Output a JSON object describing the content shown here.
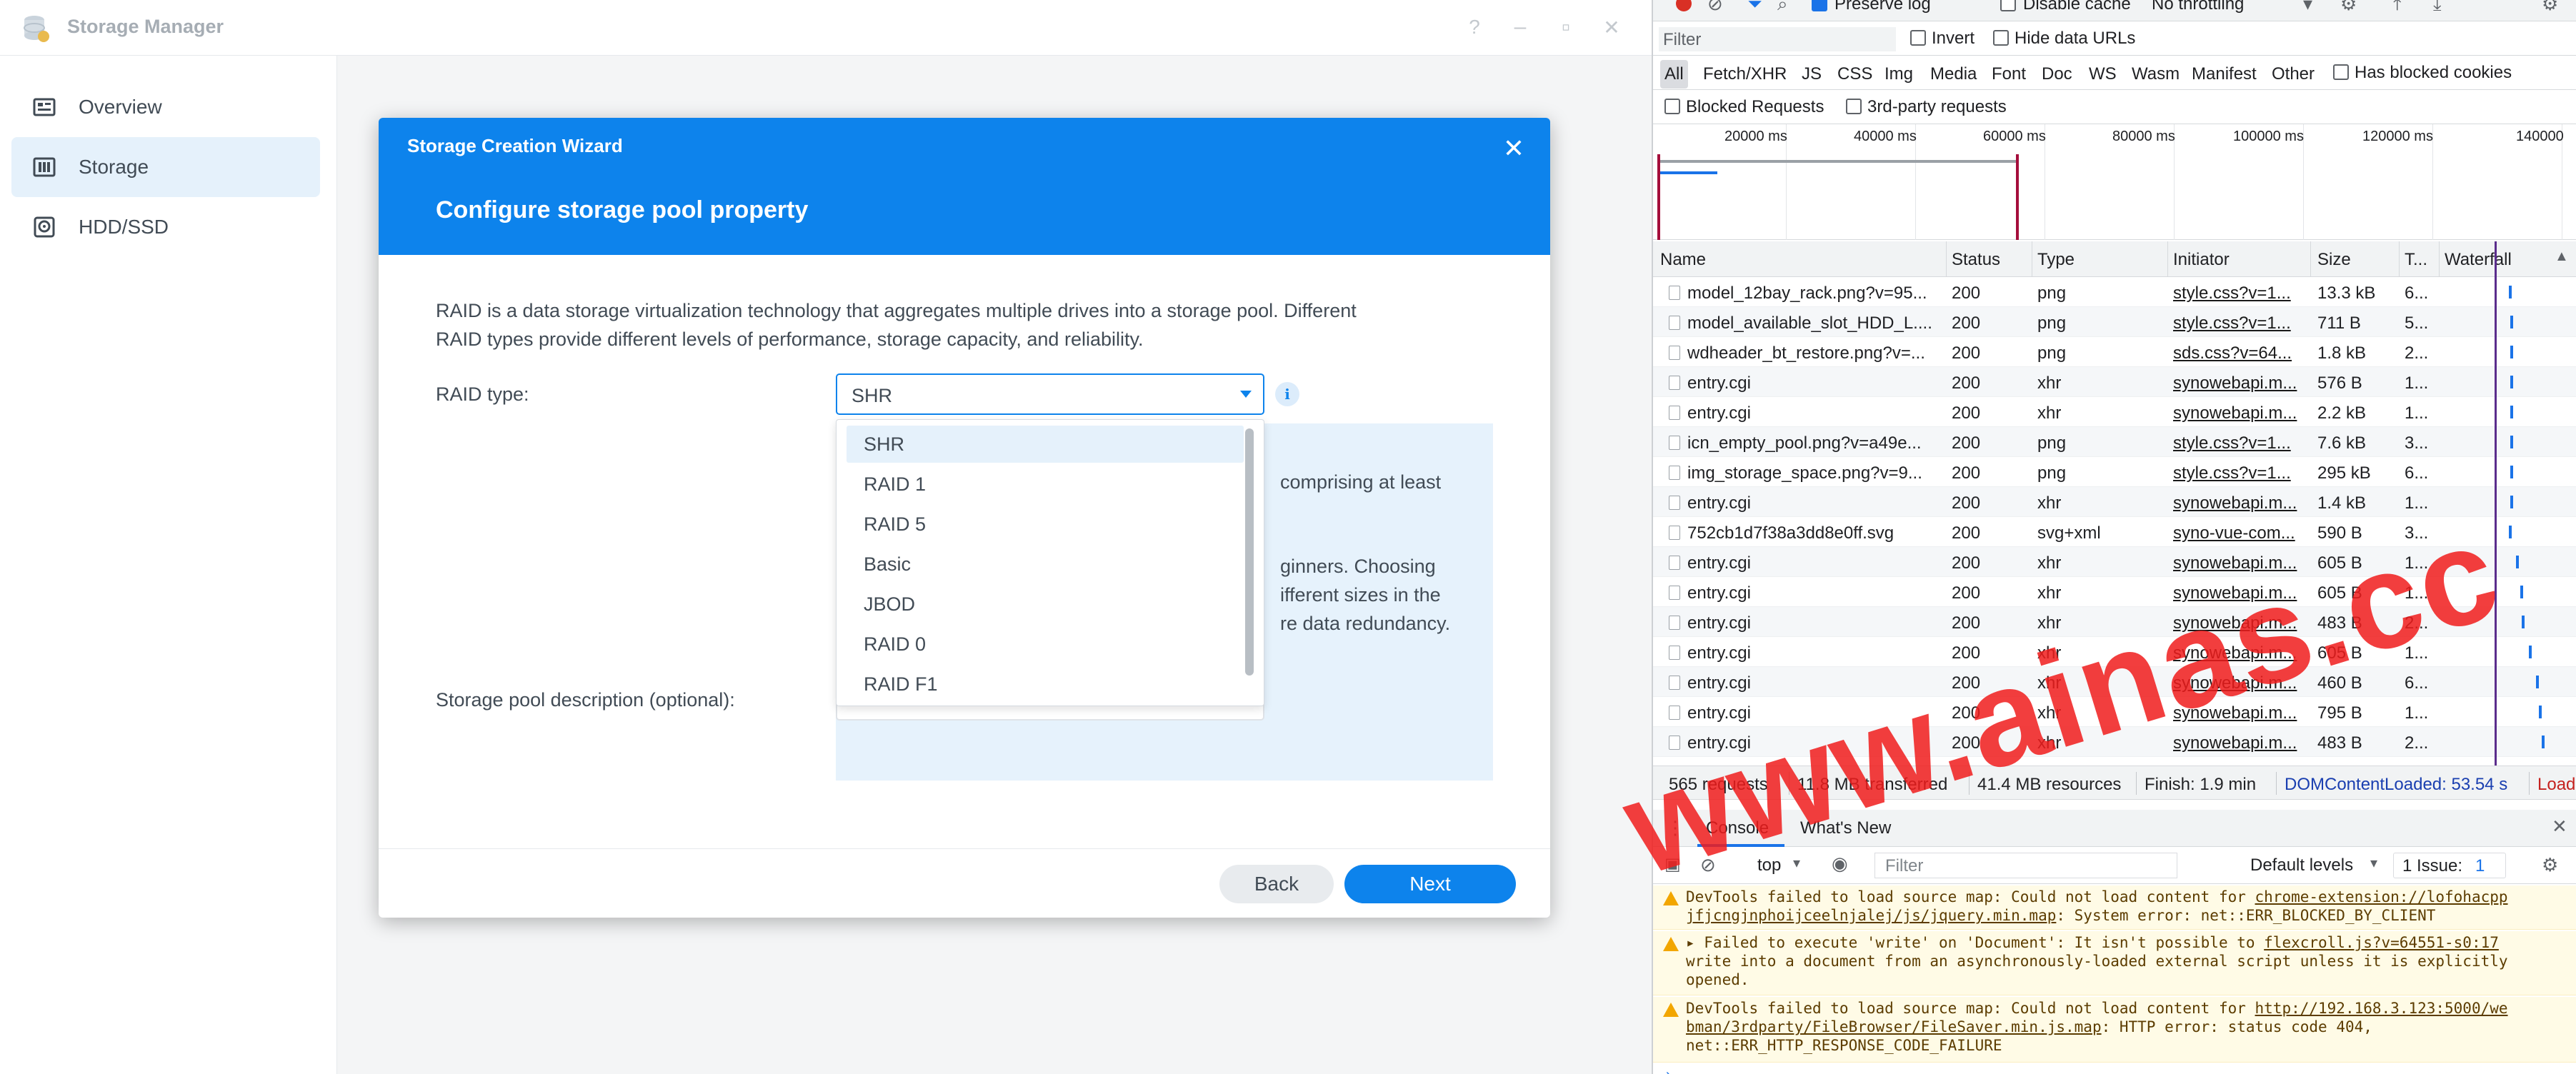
{
  "app": {
    "title": "Storage Manager",
    "window_buttons": [
      "?",
      "–",
      "▫",
      "✕"
    ]
  },
  "sidebar": {
    "items": [
      {
        "label": "Overview",
        "icon": "overview-icon",
        "active": false
      },
      {
        "label": "Storage",
        "icon": "storage-icon",
        "active": true
      },
      {
        "label": "HDD/SSD",
        "icon": "hdd-icon",
        "active": false
      }
    ]
  },
  "wizard": {
    "app_title": "Storage Creation Wizard",
    "close_glyph": "✕",
    "title": "Configure storage pool property",
    "description_line1": "RAID is a data storage virtualization technology that aggregates multiple drives into a storage pool. Different",
    "description_line2": "RAID types provide different levels of performance, storage capacity, and reliability.",
    "raid_label": "RAID type:",
    "raid_value": "SHR",
    "info_glyph": "i",
    "info_fragments": [
      "comprising at least",
      "ginners. Choosing",
      "ifferent sizes in the",
      "re data redundancy."
    ],
    "raid_options": [
      "SHR",
      "RAID 1",
      "RAID 5",
      "Basic",
      "JBOD",
      "RAID 0",
      "RAID F1"
    ],
    "desc_label": "Storage pool description (optional):",
    "back_label": "Back",
    "next_label": "Next"
  },
  "devtools": {
    "top_row": {
      "preserve_log": "Preserve log",
      "disable_cache": "Disable cache",
      "throttling": "No throttling"
    },
    "filter": {
      "placeholder": "Filter",
      "invert": "Invert",
      "hide_data_urls": "Hide data URLs"
    },
    "type_filters": [
      "All",
      "Fetch/XHR",
      "JS",
      "CSS",
      "Img",
      "Media",
      "Font",
      "Doc",
      "WS",
      "Wasm",
      "Manifest",
      "Other"
    ],
    "has_blocked_cookies": "Has blocked cookies",
    "blocked_requests": "Blocked Requests",
    "third_party": "3rd-party requests",
    "timeline_labels": [
      "20000 ms",
      "40000 ms",
      "60000 ms",
      "80000 ms",
      "100000 ms",
      "120000 ms",
      "140000"
    ],
    "columns": [
      "Name",
      "Status",
      "Type",
      "Initiator",
      "Size",
      "T...",
      "Waterfall"
    ],
    "rows": [
      {
        "name": "model_12bay_rack.png?v=95...",
        "status": "200",
        "type": "png",
        "initiator": "style.css?v=1...",
        "size": "13.3 kB",
        "time": "6..."
      },
      {
        "name": "model_available_slot_HDD_L....",
        "status": "200",
        "type": "png",
        "initiator": "style.css?v=1...",
        "size": "711 B",
        "time": "5..."
      },
      {
        "name": "wdheader_bt_restore.png?v=...",
        "status": "200",
        "type": "png",
        "initiator": "sds.css?v=64...",
        "size": "1.8 kB",
        "time": "2..."
      },
      {
        "name": "entry.cgi",
        "status": "200",
        "type": "xhr",
        "initiator": "synowebapi.m...",
        "size": "576 B",
        "time": "1..."
      },
      {
        "name": "entry.cgi",
        "status": "200",
        "type": "xhr",
        "initiator": "synowebapi.m...",
        "size": "2.2 kB",
        "time": "1..."
      },
      {
        "name": "icn_empty_pool.png?v=a49e...",
        "status": "200",
        "type": "png",
        "initiator": "style.css?v=1...",
        "size": "7.6 kB",
        "time": "3..."
      },
      {
        "name": "img_storage_space.png?v=9...",
        "status": "200",
        "type": "png",
        "initiator": "style.css?v=1...",
        "size": "295 kB",
        "time": "6..."
      },
      {
        "name": "entry.cgi",
        "status": "200",
        "type": "xhr",
        "initiator": "synowebapi.m...",
        "size": "1.4 kB",
        "time": "1..."
      },
      {
        "name": "752cb1d7f38a3dd8e0ff.svg",
        "status": "200",
        "type": "svg+xml",
        "initiator": "syno-vue-com...",
        "size": "590 B",
        "time": "3..."
      },
      {
        "name": "entry.cgi",
        "status": "200",
        "type": "xhr",
        "initiator": "synowebapi.m...",
        "size": "605 B",
        "time": "1..."
      },
      {
        "name": "entry.cgi",
        "status": "200",
        "type": "xhr",
        "initiator": "synowebapi.m...",
        "size": "605 B",
        "time": "1..."
      },
      {
        "name": "entry.cgi",
        "status": "200",
        "type": "xhr",
        "initiator": "synowebapi.m...",
        "size": "483 B",
        "time": "2..."
      },
      {
        "name": "entry.cgi",
        "status": "200",
        "type": "xhr",
        "initiator": "synowebapi.m...",
        "size": "605 B",
        "time": "1..."
      },
      {
        "name": "entry.cgi",
        "status": "200",
        "type": "xhr",
        "initiator": "synowebapi.m...",
        "size": "460 B",
        "time": "6..."
      },
      {
        "name": "entry.cgi",
        "status": "200",
        "type": "xhr",
        "initiator": "synowebapi.m...",
        "size": "795 B",
        "time": "1..."
      },
      {
        "name": "entry.cgi",
        "status": "200",
        "type": "xhr",
        "initiator": "synowebapi.m...",
        "size": "483 B",
        "time": "2..."
      }
    ],
    "status_bar": {
      "requests": "565 requests",
      "transferred": "11.8 MB transferred",
      "resources": "41.4 MB resources",
      "finish": "Finish: 1.9 min",
      "dom_loaded": "DOMContentLoaded: 53.54 s",
      "load": "Load"
    },
    "console": {
      "tab_console": "Console",
      "tab_whats_new": "What's New",
      "context": "top",
      "filter_placeholder": "Filter",
      "levels": "Default levels",
      "issues": "1 Issue:",
      "issue_count": "1",
      "messages": [
        {
          "line1_prefix": "DevTools failed to load source map: Could not load content for ",
          "line1_link": "chrome-extension://lofohacpp",
          "line2_link": "jfjcngjnphoijceelnjalej/js/jquery.min.map",
          "line2_suffix": ": System error: net::ERR_BLOCKED_BY_CLIENT"
        },
        {
          "line1_prefix": "▸ Failed to execute 'write' on 'Document': It isn't possible to ",
          "line1_link": "flexcroll.js?v=64551-s0:17",
          "line2": "write into a document from an asynchronously-loaded external script unless it is explicitly",
          "line3": "opened."
        },
        {
          "line1_prefix": "DevTools failed to load source map: Could not load content for ",
          "line1_link": "http://192.168.3.123:5000/we",
          "line2_link": "bman/3rdparty/FileBrowser/FileSaver.min.js.map",
          "line2_suffix": ": HTTP error: status code 404,",
          "line3": "net::ERR_HTTP_RESPONSE_CODE_FAILURE"
        }
      ]
    }
  },
  "watermark": "www.ainas.cc",
  "colors": {
    "accent": "#0d83ec",
    "sidebar_active": "#e5f1fb",
    "watermark": "#f01c1c",
    "warning_bg": "#fffbe6"
  }
}
